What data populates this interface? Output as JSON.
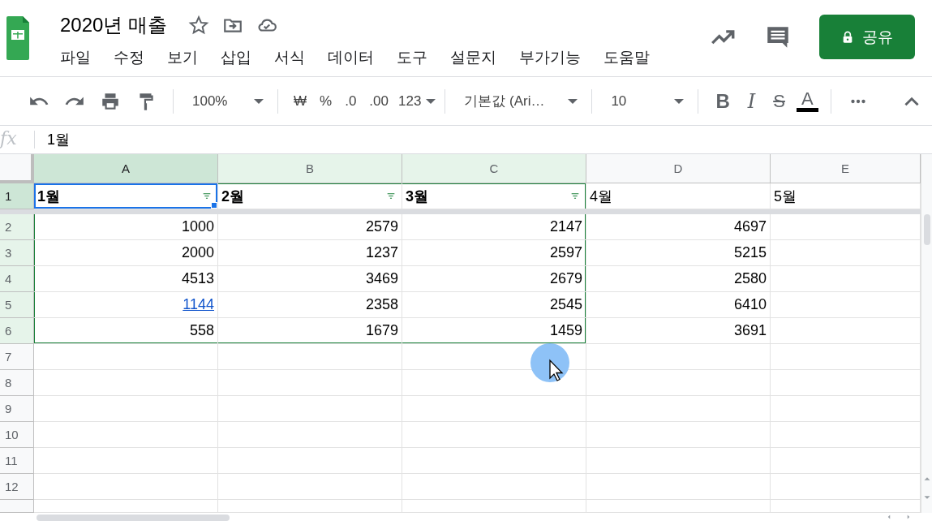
{
  "window": {
    "title": "2020년 매출"
  },
  "menu": [
    "파일",
    "수정",
    "보기",
    "삽입",
    "서식",
    "데이터",
    "도구",
    "설문지",
    "부가기능",
    "도움말"
  ],
  "share_button": {
    "label": "공유"
  },
  "toolbar": {
    "zoom": "100%",
    "currency": "₩",
    "percent": "%",
    "decrease_decimals": ".0",
    "increase_decimals": ".00",
    "number_format": "123",
    "font": "기본값 (Ari…",
    "font_size": "10",
    "bold": "B",
    "italic": "I",
    "strikethrough": "S",
    "text_color": "A"
  },
  "formula_bar": {
    "label": "fx",
    "value": "1월"
  },
  "grid": {
    "columns": [
      {
        "label": "A",
        "selected": true,
        "in_range": true
      },
      {
        "label": "B",
        "selected": false,
        "in_range": true
      },
      {
        "label": "C",
        "selected": false,
        "in_range": true
      },
      {
        "label": "D",
        "selected": false,
        "in_range": false
      },
      {
        "label": "E",
        "selected": false,
        "in_range": false
      }
    ],
    "rows": [
      {
        "label": "1",
        "selected": true,
        "in_range": true,
        "cells": [
          {
            "text": "1월",
            "kind": "header",
            "filter": true,
            "active": true
          },
          {
            "text": "2월",
            "kind": "header",
            "filter": true,
            "active": false
          },
          {
            "text": "3월",
            "kind": "header",
            "filter": true,
            "active": false
          },
          {
            "text": "4월",
            "kind": "text",
            "filter": false,
            "active": false
          },
          {
            "text": "5월",
            "kind": "text",
            "filter": false,
            "active": false
          }
        ]
      },
      {
        "label": "2",
        "selected": false,
        "in_range": true,
        "cells": [
          {
            "text": "1000",
            "kind": "number"
          },
          {
            "text": "2579",
            "kind": "number"
          },
          {
            "text": "2147",
            "kind": "number"
          },
          {
            "text": "4697",
            "kind": "number"
          }
        ]
      },
      {
        "label": "3",
        "selected": false,
        "in_range": true,
        "cells": [
          {
            "text": "2000",
            "kind": "number"
          },
          {
            "text": "1237",
            "kind": "number"
          },
          {
            "text": "2597",
            "kind": "number"
          },
          {
            "text": "5215",
            "kind": "number"
          }
        ]
      },
      {
        "label": "4",
        "selected": false,
        "in_range": true,
        "cells": [
          {
            "text": "4513",
            "kind": "number"
          },
          {
            "text": "3469",
            "kind": "number"
          },
          {
            "text": "2679",
            "kind": "number"
          },
          {
            "text": "2580",
            "kind": "number"
          }
        ]
      },
      {
        "label": "5",
        "selected": false,
        "in_range": true,
        "cells": [
          {
            "text": "1144",
            "kind": "link"
          },
          {
            "text": "2358",
            "kind": "number"
          },
          {
            "text": "2545",
            "kind": "number"
          },
          {
            "text": "6410",
            "kind": "number"
          }
        ]
      },
      {
        "label": "6",
        "selected": false,
        "in_range": true,
        "cells": [
          {
            "text": "558",
            "kind": "number"
          },
          {
            "text": "1679",
            "kind": "number"
          },
          {
            "text": "1459",
            "kind": "number"
          },
          {
            "text": "3691",
            "kind": "number"
          }
        ]
      },
      {
        "label": "7",
        "selected": false,
        "in_range": false
      },
      {
        "label": "8",
        "selected": false,
        "in_range": false
      },
      {
        "label": "9",
        "selected": false,
        "in_range": false
      },
      {
        "label": "10",
        "selected": false,
        "in_range": false
      },
      {
        "label": "11",
        "selected": false,
        "in_range": false
      },
      {
        "label": "12",
        "selected": false,
        "in_range": false
      }
    ]
  }
}
